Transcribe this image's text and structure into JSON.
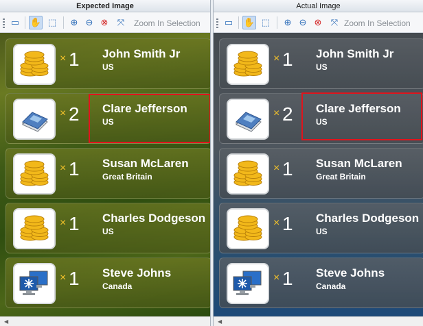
{
  "panes": {
    "left": {
      "title": "Expected Image"
    },
    "right": {
      "title": "Actual Image"
    }
  },
  "toolbar": {
    "zoom_label": "Zoom In Selection"
  },
  "rows": [
    {
      "icon": "coins-icon",
      "multiplier": "×",
      "qty": "1",
      "name": "John Smith Jr",
      "country": "US"
    },
    {
      "icon": "book-icon",
      "multiplier": "×",
      "qty": "2",
      "name": "Clare Jefferson",
      "country": "US"
    },
    {
      "icon": "coins-icon",
      "multiplier": "×",
      "qty": "1",
      "name": "Susan McLaren",
      "country": "Great Britain"
    },
    {
      "icon": "coins-icon",
      "multiplier": "×",
      "qty": "1",
      "name": "Charles Dodgeson",
      "country": "US"
    },
    {
      "icon": "computers-icon",
      "multiplier": "×",
      "qty": "1",
      "name": "Steve Johns",
      "country": "Canada"
    }
  ],
  "colors": {
    "selection": "#e0141c",
    "multiplier": "#f3c22a",
    "active_tool": "#c8dcf3"
  }
}
